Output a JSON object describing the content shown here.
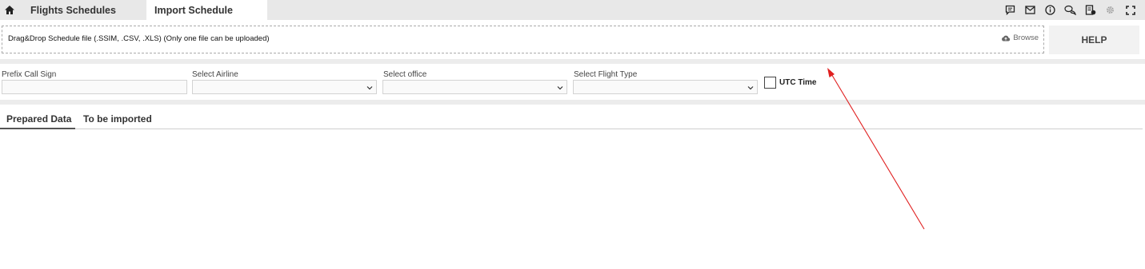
{
  "header": {
    "tabs": [
      {
        "label": "Flights Schedules"
      },
      {
        "label": "Import Schedule"
      }
    ],
    "icons": [
      "home-icon",
      "message-icon",
      "mail-icon",
      "info-icon",
      "chat-icon",
      "report-icon",
      "gear-icon",
      "fullscreen-icon"
    ]
  },
  "upload": {
    "text": "Drag&Drop Schedule file (.SSIM, .CSV, .XLS) (Only one file can be uploaded)",
    "browse_label": "Browse"
  },
  "help_label": "HELP",
  "filters": {
    "prefix_label": "Prefix Call Sign",
    "prefix_value": "",
    "airline_label": "Select Airline",
    "airline_value": "",
    "office_label": "Select office",
    "office_value": "",
    "flight_type_label": "Select Flight Type",
    "flight_type_value": "",
    "utc_label": "UTC Time",
    "utc_checked": false
  },
  "data_tabs": [
    {
      "label": "Prepared Data",
      "active": true
    },
    {
      "label": "To be imported",
      "active": false
    }
  ],
  "colors": {
    "annotation_arrow": "#e02020",
    "tabbar_bg": "#e8e8e8"
  }
}
